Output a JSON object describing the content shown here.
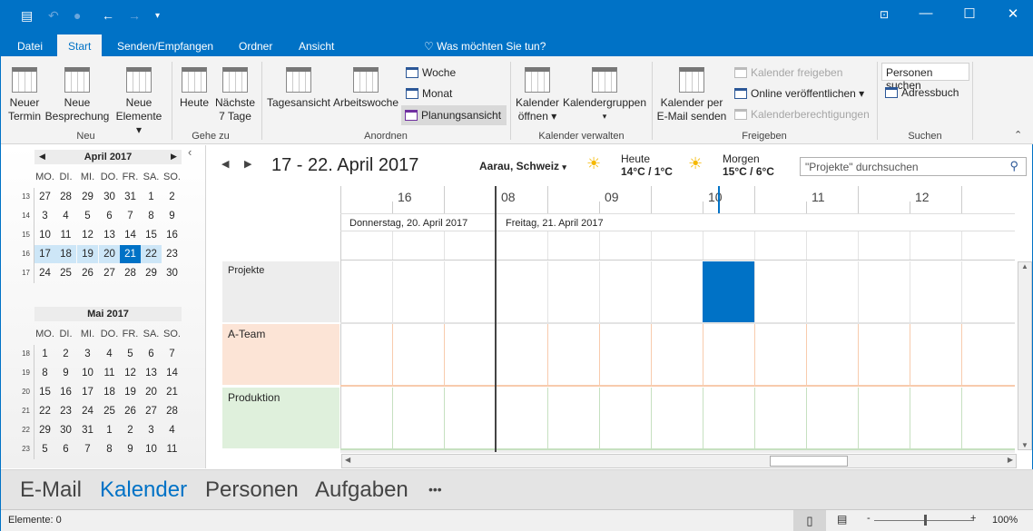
{
  "titlebar": {
    "quick_access": [
      "outlook-icon",
      "undo-icon",
      "user-status-icon",
      "back-icon",
      "forward-icon",
      "customize-icon"
    ],
    "window_controls": [
      "ribbon-display-icon",
      "minimize-icon",
      "maximize-icon",
      "close-icon"
    ],
    "accent": "#0072C6"
  },
  "tabs": [
    {
      "label": "Datei"
    },
    {
      "label": "Start",
      "active": true
    },
    {
      "label": "Senden/Empfangen"
    },
    {
      "label": "Ordner"
    },
    {
      "label": "Ansicht"
    }
  ],
  "tell_me": "Was möchten Sie tun?",
  "ribbon": {
    "groups": [
      {
        "label": "Neu"
      },
      {
        "label": "Gehe zu"
      },
      {
        "label": "Anordnen"
      },
      {
        "label": "Kalender verwalten"
      },
      {
        "label": "Freigeben"
      },
      {
        "label": "Suchen"
      }
    ],
    "neuer_termin": [
      "Neuer",
      "Termin"
    ],
    "neue_besprechung": [
      "Neue",
      "Besprechung"
    ],
    "neue_elemente": [
      "Neue",
      "Elemente ▾"
    ],
    "heute": "Heute",
    "naechste": [
      "Nächste",
      "7 Tage"
    ],
    "tagesansicht": "Tagesansicht",
    "arbeitswoche": "Arbeitswoche",
    "woche": "Woche",
    "monat": "Monat",
    "planungsansicht": "Planungsansicht",
    "kalender_oeffnen": [
      "Kalender",
      "öffnen ▾"
    ],
    "kalendergruppen": [
      "Kalendergruppen",
      "▾"
    ],
    "kalender_email": [
      "Kalender per",
      "E-Mail senden"
    ],
    "kalender_freigeben": "Kalender freigeben",
    "online": "Online veröffentlichen ▾",
    "berechtigungen": "Kalenderberechtigungen",
    "personen_suchen": "Personen suchen",
    "adressbuch": "Adressbuch"
  },
  "mini_calendars": [
    {
      "title": "April 2017",
      "days": [
        "MO.",
        "DI.",
        "MI.",
        "DO.",
        "FR.",
        "SA.",
        "SO."
      ],
      "weeks": [
        {
          "n": "13",
          "d": [
            "27",
            "28",
            "29",
            "30",
            "31",
            "1",
            "2"
          ]
        },
        {
          "n": "14",
          "d": [
            "3",
            "4",
            "5",
            "6",
            "7",
            "8",
            "9"
          ]
        },
        {
          "n": "15",
          "d": [
            "10",
            "11",
            "12",
            "13",
            "14",
            "15",
            "16"
          ]
        },
        {
          "n": "16",
          "d": [
            "17",
            "18",
            "19",
            "20",
            "21",
            "22",
            "23"
          ]
        },
        {
          "n": "17",
          "d": [
            "24",
            "25",
            "26",
            "27",
            "28",
            "29",
            "30"
          ]
        }
      ]
    },
    {
      "title": "Mai 2017",
      "days": [
        "MO.",
        "DI.",
        "MI.",
        "DO.",
        "FR.",
        "SA.",
        "SO."
      ],
      "weeks": [
        {
          "n": "18",
          "d": [
            "1",
            "2",
            "3",
            "4",
            "5",
            "6",
            "7"
          ]
        },
        {
          "n": "19",
          "d": [
            "8",
            "9",
            "10",
            "11",
            "12",
            "13",
            "14"
          ]
        },
        {
          "n": "20",
          "d": [
            "15",
            "16",
            "17",
            "18",
            "19",
            "20",
            "21"
          ]
        },
        {
          "n": "21",
          "d": [
            "22",
            "23",
            "24",
            "25",
            "26",
            "27",
            "28"
          ]
        },
        {
          "n": "22",
          "d": [
            "29",
            "30",
            "31",
            "1",
            "2",
            "3",
            "4"
          ]
        },
        {
          "n": "23",
          "d": [
            "5",
            "6",
            "7",
            "8",
            "9",
            "10",
            "11"
          ]
        }
      ]
    }
  ],
  "selected_day": "21",
  "main": {
    "date_range": "17 - 22. April 2017",
    "location": "Aarau, Schweiz",
    "weather": [
      {
        "label": "Heute",
        "temp": "14°C / 1°C",
        "icon": "sun-cloud-icon"
      },
      {
        "label": "Morgen",
        "temp": "15°C / 6°C",
        "icon": "sun-cloud-icon"
      }
    ],
    "search_placeholder": "\"Projekte\" durchsuchen",
    "hours": [
      "16",
      "08",
      "09",
      "10",
      "11",
      "12"
    ],
    "dates": [
      "Donnerstag, 20. April 2017",
      "Freitag, 21. April 2017"
    ],
    "rows": [
      {
        "label": "Projekte",
        "color": "#EDEDED",
        "line": "#E3E3E3"
      },
      {
        "label": "A-Team",
        "color": "#FCE4D6",
        "line": "#F8CBAD"
      },
      {
        "label": "Produktion",
        "color": "#DFF0DC",
        "line": "#C6E0C0"
      }
    ],
    "event_color": "#0072C6"
  },
  "navbar": [
    {
      "label": "E-Mail"
    },
    {
      "label": "Kalender",
      "active": true
    },
    {
      "label": "Personen"
    },
    {
      "label": "Aufgaben"
    },
    {
      "label": "•••"
    }
  ],
  "status": {
    "items": "Elemente: 0",
    "zoom": "100%",
    "zoom_level": 100
  }
}
